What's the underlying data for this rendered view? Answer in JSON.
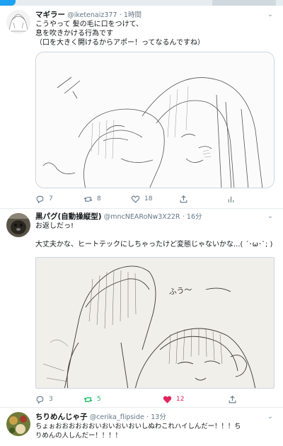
{
  "tweets": [
    {
      "name": "マギラー",
      "handle": "@iketenaiz377",
      "dot": "·",
      "time": "1時間",
      "lines": [
        "こうやって 髪の毛に口をつけて、",
        "息を吹きかける行為です",
        "（口を大きく開けるからアポー！ってなるんですね）"
      ],
      "reply_count": "7",
      "retweet_count": "8",
      "like_count": "18"
    },
    {
      "name": "黒パグ(自動操縦型)",
      "handle": "@mncNEARoNw3X22R",
      "dot": "·",
      "time": "16分",
      "lines": [
        "お返しだっ!",
        "",
        "大丈夫かな、ヒートテックにしちゃったけど変態じゃないかな...( ´･ω･`; )"
      ],
      "sketch_text": "ふう〜",
      "reply_count": "3",
      "retweet_count": "5",
      "like_count": "12"
    },
    {
      "name": "ちりめんじゃ子",
      "handle": "@cerika_flipside",
      "dot": "·",
      "time": "13分",
      "lines": [
        "ちょぉおおおおおおいおいおいおいしぬわこれハイしんだー！！！ち",
        "りめんの人しんだー！！！！"
      ]
    }
  ],
  "icons": {
    "menu": "chevron-down-icon",
    "reply": "reply-icon",
    "retweet": "retweet-icon",
    "like": "heart-icon",
    "share": "share-icon",
    "analytics": "analytics-icon"
  },
  "colors": {
    "retweet_active": "#17bf63",
    "like_active": "#e0245e",
    "secondary_text": "#657786"
  }
}
